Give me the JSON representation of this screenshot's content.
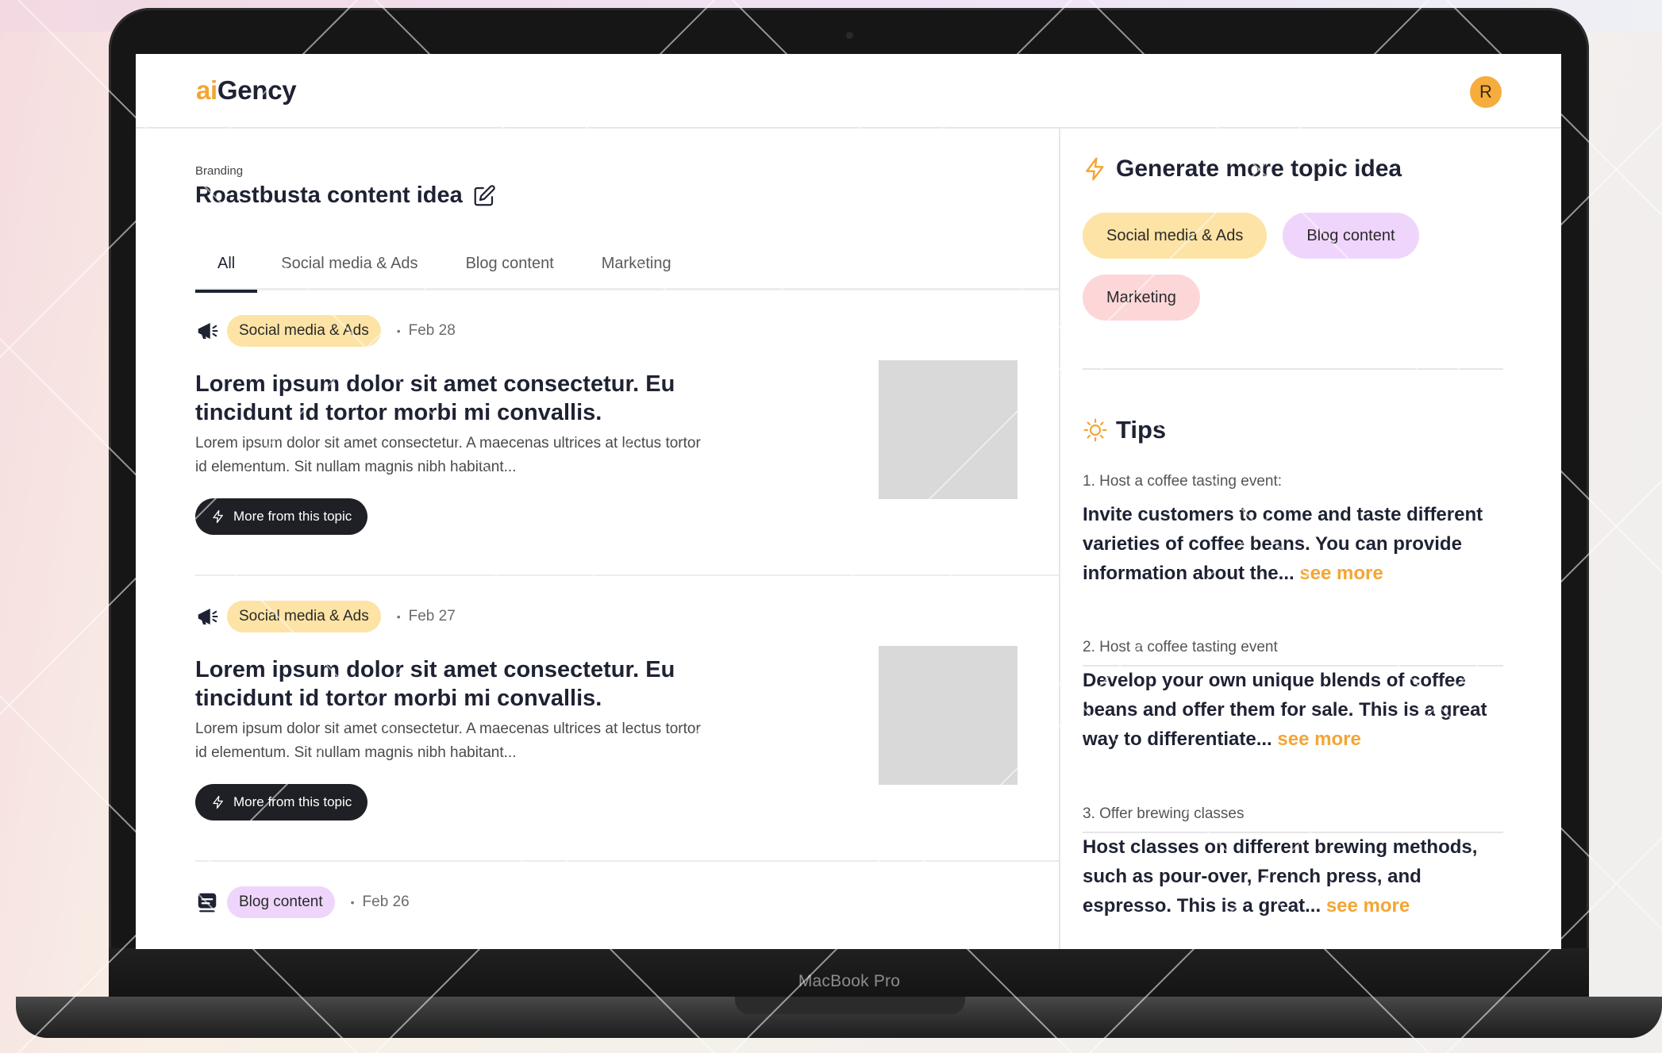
{
  "app": {
    "logo_prefix": "ai",
    "logo_suffix": "Gency",
    "avatar_initial": "R"
  },
  "device": {
    "label": "MacBook Pro"
  },
  "header": {
    "breadcrumb": "Branding",
    "title": "Roastbusta content idea"
  },
  "tabs": [
    {
      "label": "All",
      "active": true
    },
    {
      "label": "Social media & Ads"
    },
    {
      "label": "Blog content"
    },
    {
      "label": "Marketing"
    }
  ],
  "posts": [
    {
      "category": "Social media & Ads",
      "category_icon": "megaphone-icon",
      "date": "Feb 28",
      "title": "Lorem ipsum dolor sit amet consectetur. Eu tincidunt id tortor morbi mi convallis.",
      "excerpt": "Lorem ipsum dolor sit amet consectetur. A maecenas ultrices at lectus tortor id elementum. Sit nullam magnis nibh habitant...",
      "button_label": "More from this topic"
    },
    {
      "category": "Social media & Ads",
      "category_icon": "megaphone-icon",
      "date": "Feb 27",
      "title": "Lorem ipsum dolor sit amet consectetur. Eu tincidunt id tortor morbi mi convallis.",
      "excerpt": "Lorem ipsum dolor sit amet consectetur. A maecenas ultrices at lectus tortor id elementum. Sit nullam magnis nibh habitant...",
      "button_label": "More from this topic"
    },
    {
      "category": "Blog content",
      "category_icon": "blog-icon",
      "date": "Feb 26"
    }
  ],
  "sidebar": {
    "generate_title": "Generate more topic idea",
    "chips": [
      "Social media & Ads",
      "Blog content",
      "Marketing"
    ],
    "tips_title": "Tips",
    "see_more_label": "see more",
    "tips": [
      {
        "label": "1. Host a coffee tasting event:",
        "body": "Invite customers to come and taste different varieties of coffee beans. You can provide information about the..."
      },
      {
        "label": "2. Host a coffee tasting event",
        "body": "Develop your own unique blends of coffee beans and offer them for sale. This is a great way to differentiate..."
      },
      {
        "label": "3. Offer brewing classes",
        "body": "Host classes on different brewing methods, such as pour-over, French press, and espresso. This is a great..."
      }
    ]
  },
  "colors": {
    "accent": "#f4a533",
    "dark": "#1e2233",
    "pill_yellow": "#fde3a5",
    "pill_purple": "#efd5fb",
    "pill_pink": "#fdd6d8"
  }
}
